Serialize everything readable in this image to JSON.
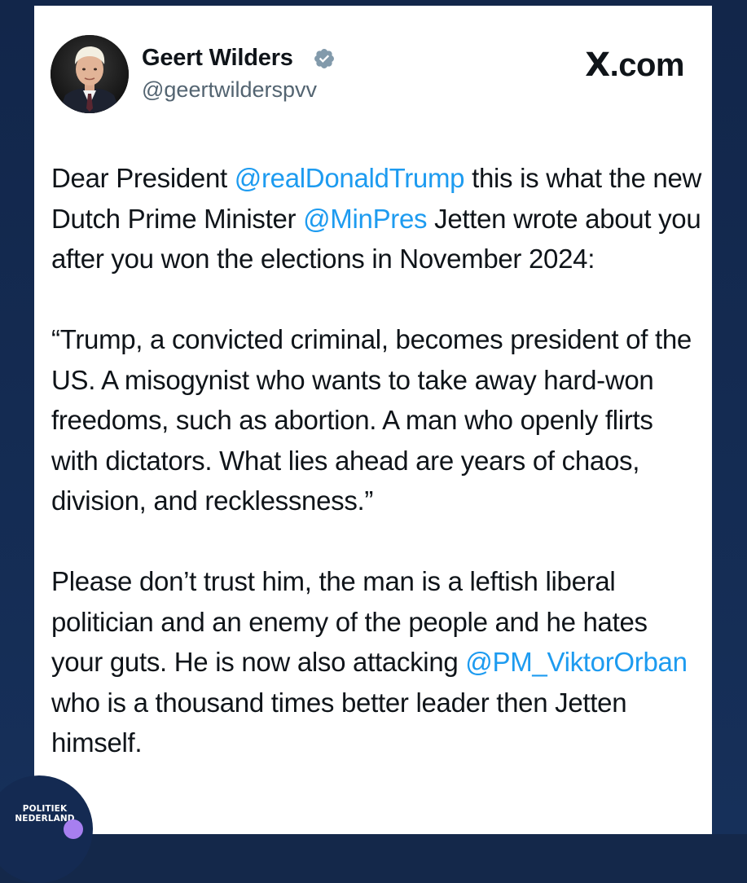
{
  "post": {
    "author_name": "Geert Wilders",
    "author_handle": "@geertwilderspvv",
    "verified": true,
    "brand": "X.com",
    "accent_color": "#1d9bf0",
    "paragraphs": [
      [
        {
          "text": "Dear President ",
          "mention": false
        },
        {
          "text": "@realDonaldTrump",
          "mention": true
        },
        {
          "text": " this is what the new Dutch Prime Minister ",
          "mention": false
        },
        {
          "text": "@MinPres",
          "mention": true
        },
        {
          "text": " Jetten wrote about you after you won the elections in November 2024:",
          "mention": false
        }
      ],
      [
        {
          "text": "“Trump, a convicted criminal, becomes president of the US. A misogynist who wants to take away hard-won freedoms, such as abortion. A man who openly flirts with dictators. What lies ahead are years of chaos, division, and recklessness.”",
          "mention": false
        }
      ],
      [
        {
          "text": "Please don’t trust him, the man is a leftish liberal politician and an enemy of the people and he hates your guts. He is now also attacking ",
          "mention": false
        },
        {
          "text": "@PM_ViktorOrban",
          "mention": true
        },
        {
          "text": " who is a thousand times better leader then Jetten himself.",
          "mention": false
        }
      ]
    ]
  },
  "watermark": {
    "line1": "POLITIEK",
    "line2": "NEDERLAND"
  }
}
